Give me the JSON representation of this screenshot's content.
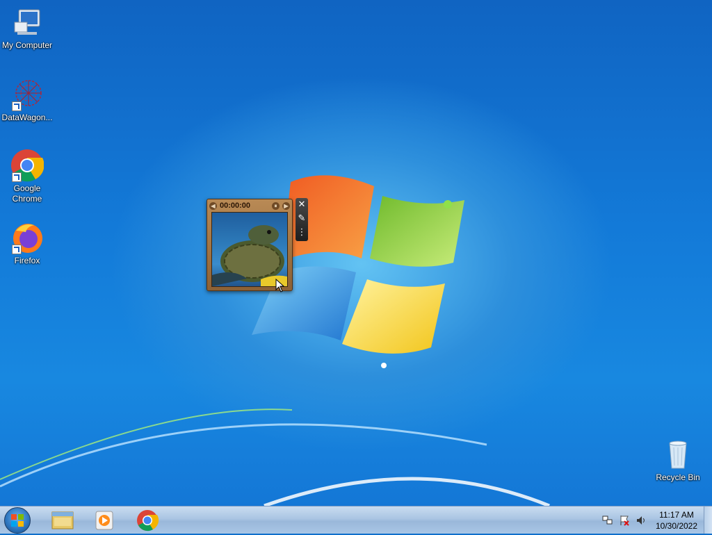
{
  "desktop": {
    "icons": [
      {
        "label": "My Computer",
        "icon": "computer-icon"
      },
      {
        "label": "DataWagon...",
        "icon": "datawagon-icon"
      },
      {
        "label": "Google Chrome",
        "icon": "chrome-icon"
      },
      {
        "label": "Firefox",
        "icon": "firefox-icon"
      },
      {
        "label": "Recycle Bin",
        "icon": "recycle-bin-icon"
      }
    ]
  },
  "gadget": {
    "name": "slide-show-gadget",
    "timer": "00:00:00",
    "photo": "sea-turtle-photo",
    "tools": [
      "close-icon",
      "options-wrench-icon",
      "drag-handle-icon"
    ]
  },
  "taskbar": {
    "start": "windows-start-icon",
    "pinned": [
      "file-explorer-icon",
      "media-player-icon",
      "chrome-icon"
    ],
    "tray": [
      "network-icon",
      "action-center-flag-icon",
      "volume-icon"
    ],
    "clock": {
      "time": "11:17 AM",
      "date": "10/30/2022"
    }
  },
  "colors": {
    "desktop_blue": "#1477d6",
    "taskbar": "#aac5e3",
    "gadget_wood": "#a87a48"
  }
}
